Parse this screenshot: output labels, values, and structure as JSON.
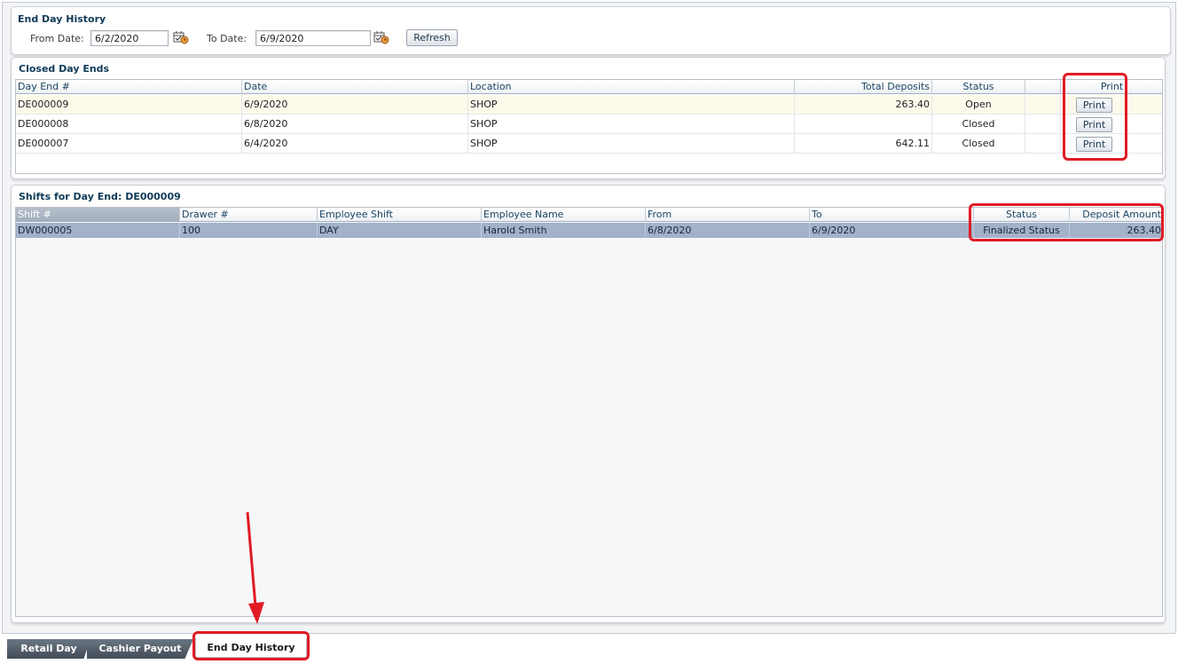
{
  "history": {
    "title": "End Day History",
    "from_label": "From Date:",
    "from_value": "6/2/2020",
    "to_label": "To Date:",
    "to_value": "6/9/2020",
    "refresh_label": "Refresh"
  },
  "closed": {
    "title": "Closed Day Ends",
    "columns": [
      "Day End #",
      "Date",
      "Location",
      "Total Deposits",
      "Status",
      "",
      "Print"
    ],
    "rows": [
      {
        "id": "DE000009",
        "date": "6/9/2020",
        "location": "SHOP",
        "deposits": "263.40",
        "status": "Open",
        "print": "Print"
      },
      {
        "id": "DE000008",
        "date": "6/8/2020",
        "location": "SHOP",
        "deposits": "",
        "status": "Closed",
        "print": "Print"
      },
      {
        "id": "DE000007",
        "date": "6/4/2020",
        "location": "SHOP",
        "deposits": "642.11",
        "status": "Closed",
        "print": "Print"
      }
    ]
  },
  "shifts": {
    "title": "Shifts for Day End: DE000009",
    "columns": [
      "Shift #",
      "Drawer #",
      "Employee Shift",
      "Employee Name",
      "From",
      "To",
      "Status",
      "Deposit Amount"
    ],
    "rows": [
      {
        "shift": "DW000005",
        "drawer": "100",
        "emp_shift": "DAY",
        "emp_name": "Harold Smith",
        "from": "6/8/2020",
        "to": "6/9/2020",
        "status": "Finalized Status",
        "amount": "263.40"
      }
    ]
  },
  "tabs": [
    "Retail Day",
    "Cashier Payout",
    "End Day History"
  ],
  "colors": {
    "accent": "#0e3a57",
    "highlight": "#e01b24",
    "selected_row": "#a3b1c9",
    "row_highlight": "#fdfaec"
  },
  "icons": {
    "calendar": "calendar-icon",
    "arrow": "annotation-arrow"
  }
}
